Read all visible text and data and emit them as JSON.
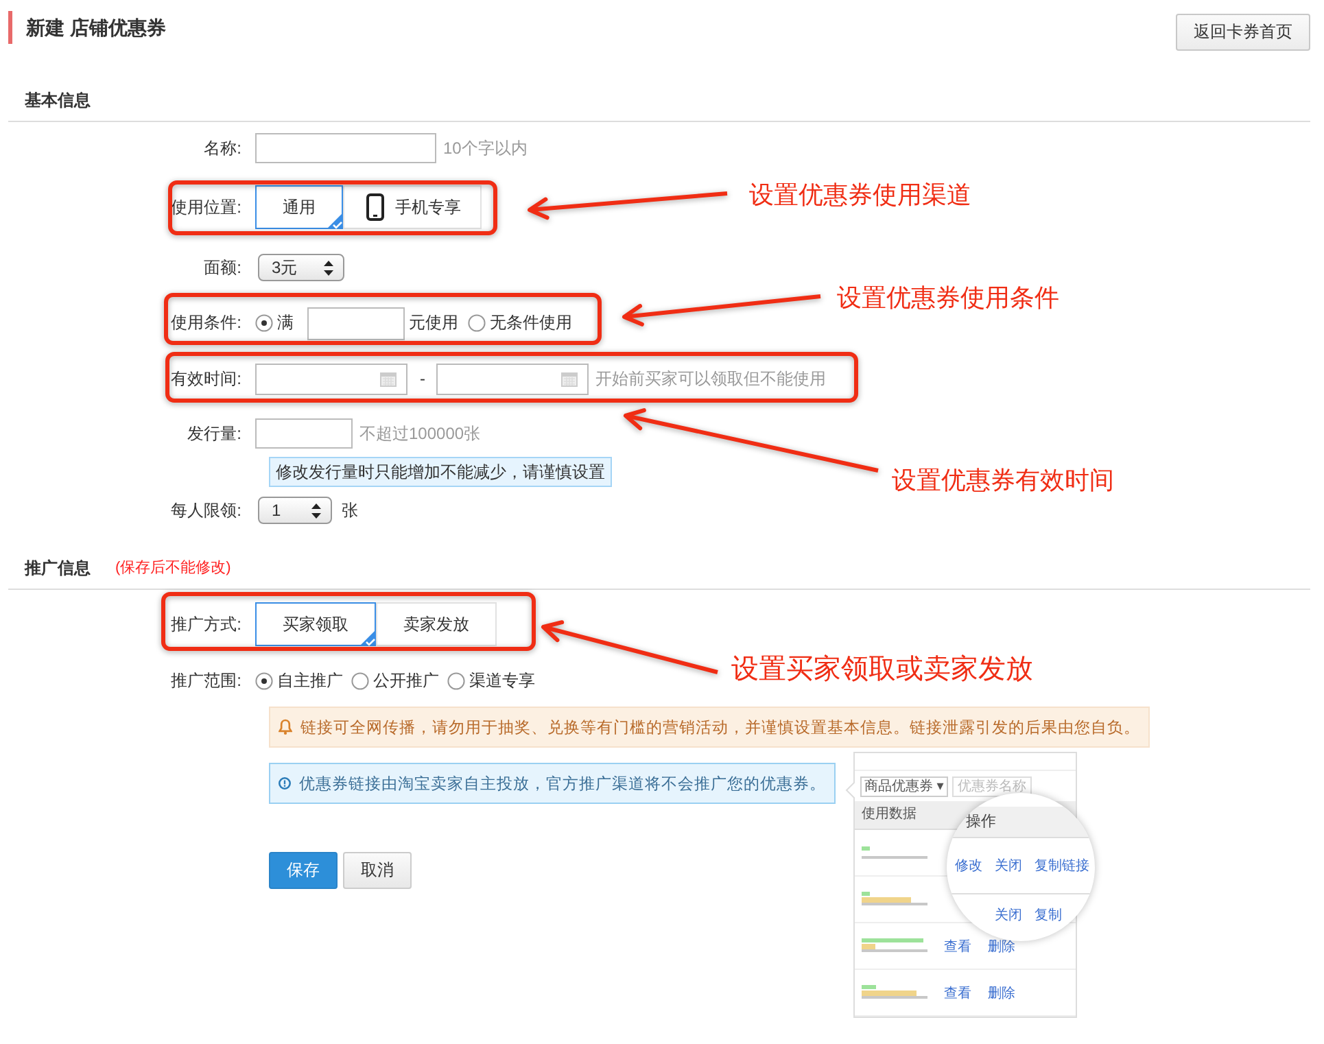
{
  "page": {
    "title": "新建 店铺优惠券",
    "back_button": "返回卡券首页"
  },
  "basic_section": {
    "title": "基本信息",
    "fields": [
      {
        "kind": "text",
        "label": "名称:",
        "hint": "10个字以内"
      },
      {
        "kind": "tiles",
        "label": "使用位置:",
        "options": [
          {
            "label": "通用",
            "kind": "plain",
            "selected": true
          },
          {
            "label": "手机专享",
            "kind": "mobile",
            "selected": false
          }
        ]
      },
      {
        "kind": "select",
        "label": "面额:",
        "value": "3元"
      },
      {
        "kind": "condition",
        "label": "使用条件:",
        "options": [
          {
            "label": "满",
            "selected": true
          },
          {
            "label": "无条件使用",
            "selected": false
          }
        ],
        "suffix": "元使用"
      },
      {
        "kind": "daterange",
        "label": "有效时间:",
        "separator": "-",
        "hint": "开始前买家可以领取但不能使用"
      },
      {
        "kind": "text",
        "label": "发行量:",
        "hint": "不超过100000张",
        "note": "修改发行量时只能增加不能减少，请谨慎设置"
      },
      {
        "kind": "select",
        "label": "每人限领:",
        "value": "1",
        "suffix": "张"
      }
    ]
  },
  "promo_section": {
    "title": "推广信息",
    "note": "(保存后不能修改)",
    "fields": [
      {
        "kind": "tiles",
        "label": "推广方式:",
        "options": [
          {
            "label": "买家领取",
            "kind": "plain",
            "selected": true
          },
          {
            "label": "卖家发放",
            "kind": "plain",
            "selected": false
          }
        ]
      },
      {
        "kind": "radios",
        "label": "推广范围:",
        "options": [
          {
            "label": "自主推广",
            "selected": true
          },
          {
            "label": "公开推广",
            "selected": false
          },
          {
            "label": "渠道专享",
            "selected": false
          }
        ]
      }
    ]
  },
  "alerts": [
    {
      "kind": "warning",
      "text": "链接可全网传播，请勿用于抽奖、兑换等有门槛的营销活动，并谨慎设置基本信息。链接泄露引发的后果由您自负。"
    },
    {
      "kind": "info",
      "text": "优惠券链接由淘宝卖家自主投放，官方推广渠道将不会推广您的优惠券。"
    }
  ],
  "actions": [
    {
      "label": "保存",
      "kind": "primary"
    },
    {
      "label": "取消",
      "kind": "default"
    }
  ],
  "preview": {
    "dropdown": "商品优惠券 ▾",
    "search_placeholder": "优惠券名称",
    "column_header": "使用数据",
    "rows": [
      {
        "links": []
      },
      {
        "links": []
      },
      {
        "links": [
          "查看",
          "删除"
        ]
      },
      {
        "links": [
          "查看",
          "删除"
        ]
      }
    ],
    "magnifier": {
      "header": "操作",
      "rows": [
        [
          "修改",
          "关闭",
          "复制链接"
        ],
        [
          "",
          "关闭",
          "复制"
        ]
      ]
    }
  },
  "annotations": [
    {
      "text": "设置优惠券使用渠道"
    },
    {
      "text": "设置优惠券使用条件"
    },
    {
      "text": "设置优惠券有效时间"
    },
    {
      "text": "设置买家领取或卖家发放"
    }
  ]
}
